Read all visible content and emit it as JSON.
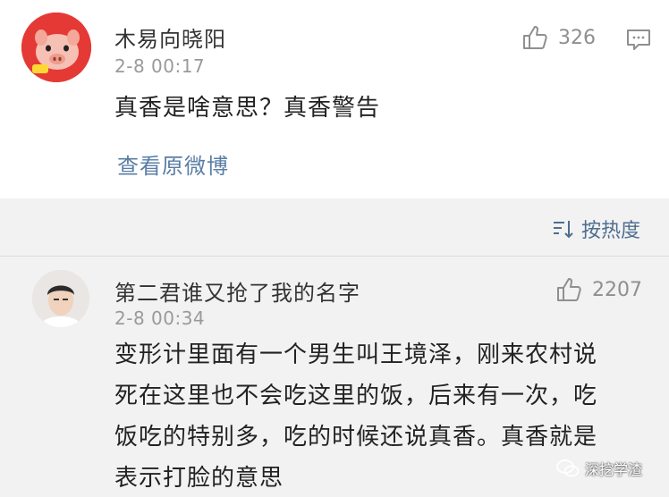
{
  "comment1": {
    "username": "木易向晓阳",
    "time": "2-8 00:17",
    "like_count": "326",
    "content": "真香是啥意思？真香警告",
    "view_original": "查看原微博"
  },
  "sort": {
    "label": "按热度"
  },
  "comment2": {
    "username": "第二君谁又抢了我的名字",
    "time": "2-8 00:34",
    "like_count": "2207",
    "content_lines": [
      "变形计里面有一个男生叫王境泽，刚来农村说",
      "死在这里也不会吃这里的饭，后来有一次，吃",
      "饭吃的特别多，吃的时候还说真香。真香就是",
      "表示打脸的意思"
    ]
  },
  "watermark": {
    "text": "深挖学渣"
  },
  "icons": {
    "like": "thumbs-up-icon",
    "reply": "comment-icon",
    "sort": "sort-icon",
    "watermark": "wechat-icon"
  }
}
